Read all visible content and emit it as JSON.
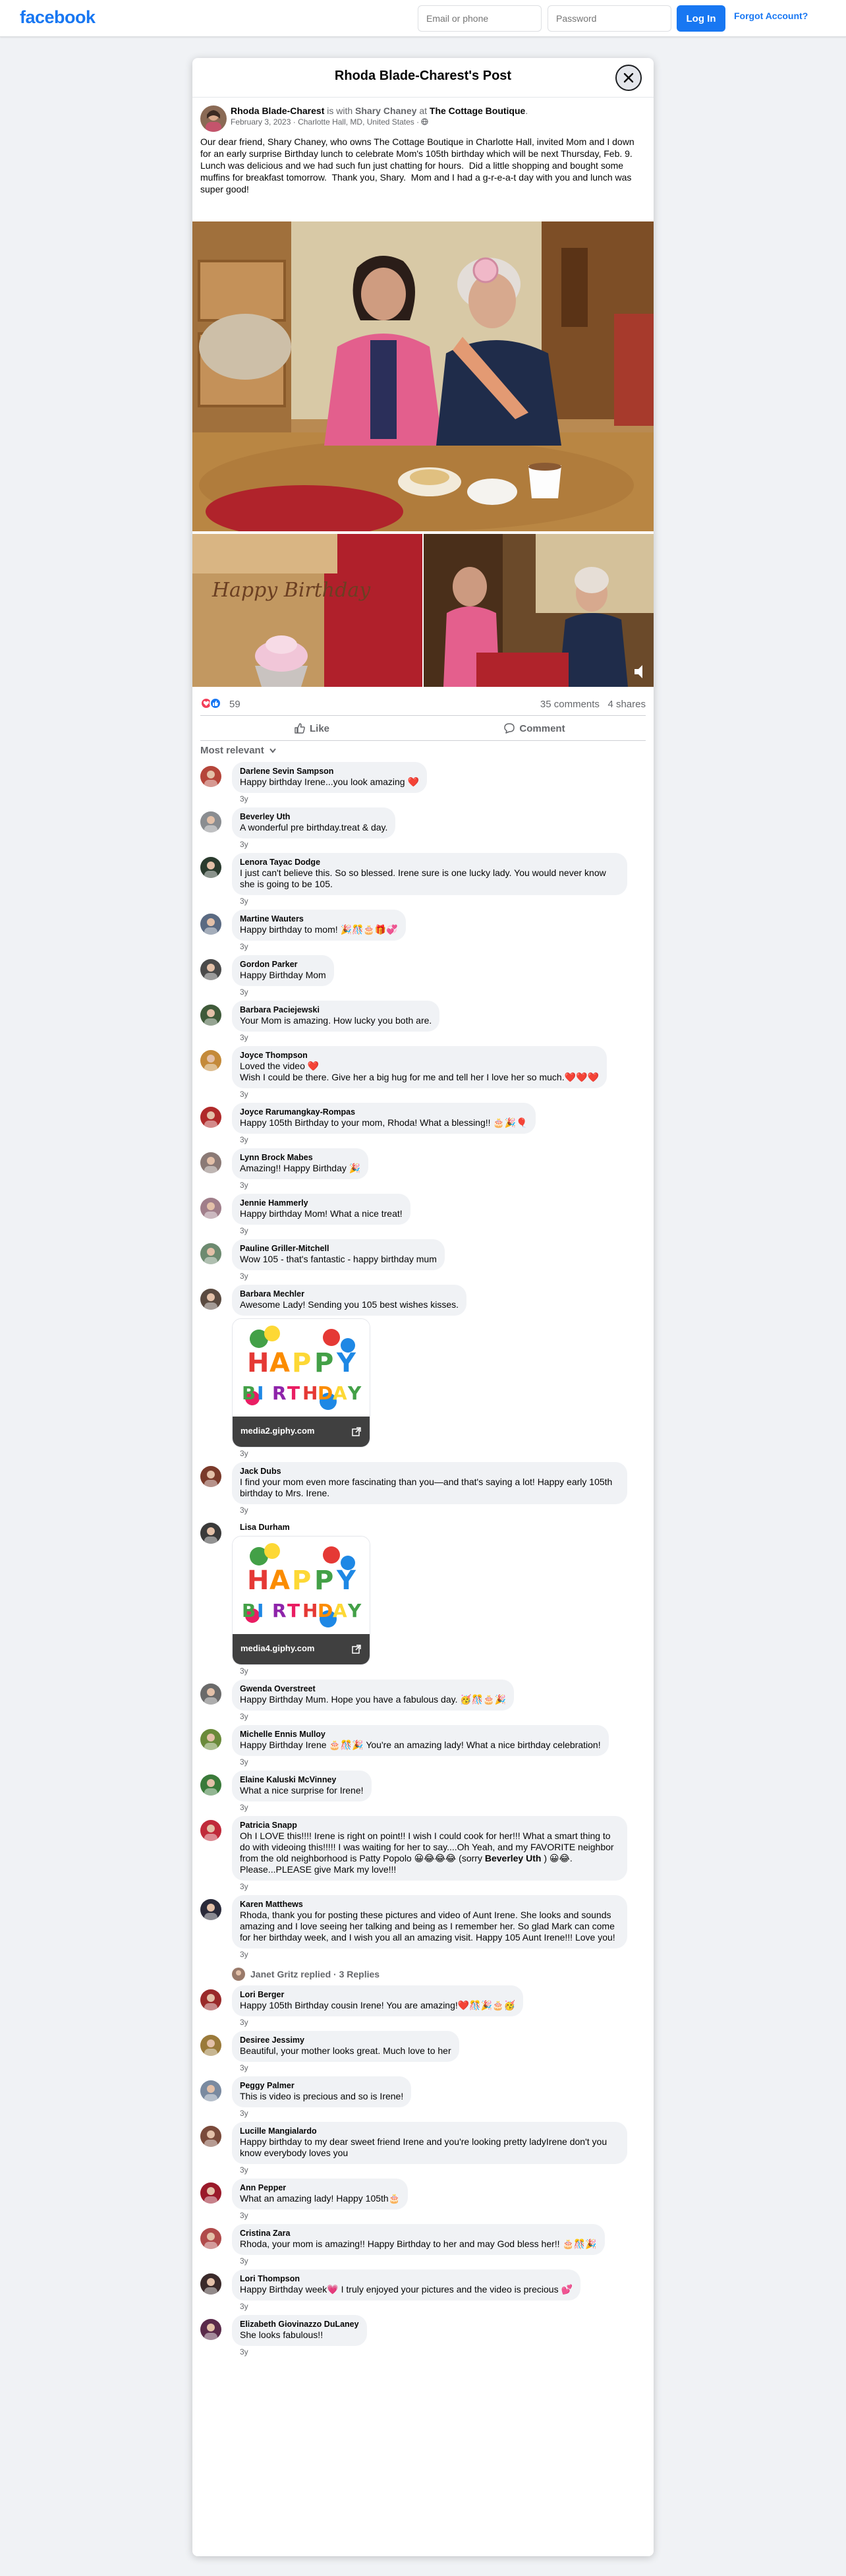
{
  "topbar": {
    "logo": "facebook",
    "email_placeholder": "Email or phone",
    "password_placeholder": "Password",
    "login_label": "Log In",
    "forgot_label": "Forgot Account?"
  },
  "dialog": {
    "title": "Rhoda Blade-Charest's Post"
  },
  "post": {
    "author": "Rhoda Blade-Charest",
    "is_with": "is with",
    "with_name": "Shary Chaney",
    "at": "at",
    "place": "The Cottage Boutique",
    "period": ".",
    "date": "February 3, 2023",
    "location": "Charlotte Hall, MD, United States",
    "text": "Our dear friend, Shary Chaney, who owns The Cottage Boutique in Charlotte Hall, invited Mom and I down for an early surprise Birthday lunch to celebrate Mom's 105th birthday which will be next Thursday, Feb. 9.  Lunch was delicious and we had such fun just chatting for hours.  Did a little shopping and bought some muffins for breakfast tomorrow.  Thank you, Shary.  Mom and I had a g-r-e-a-t day with you and lunch was super good!",
    "photo_text": "Happy Birthday",
    "reaction_count": "59",
    "comments_count": "35 comments",
    "shares_count": "4 shares",
    "like_label": "Like",
    "comment_label": "Comment",
    "sort_label": "Most relevant"
  },
  "comments": [
    {
      "name": "Darlene Sevin Sampson",
      "text": "Happy birthday Irene...you look amazing ❤️",
      "age": "3y"
    },
    {
      "name": "Beverley Uth",
      "text": "A wonderful pre birthday.treat & day.",
      "age": "3y"
    },
    {
      "name": "Lenora Tayac Dodge",
      "text": "I just can't believe this. So so blessed. Irene sure is one lucky lady. You would never know she is going to be 105.",
      "age": "3y"
    },
    {
      "name": "Martine Wauters",
      "text": "Happy birthday to mom! 🎉🎊🎂🎁💞",
      "age": "3y"
    },
    {
      "name": "Gordon Parker",
      "text": "Happy Birthday Mom",
      "age": "3y"
    },
    {
      "name": "Barbara Paciejewski",
      "text": "Your Mom is amazing. How lucky you both are.",
      "age": "3y"
    },
    {
      "name": "Joyce Thompson",
      "text": "Loved the video ❤️\nWish I could be there. Give her a big hug for me and tell her I love her so much.❤️❤️❤️",
      "age": "3y"
    },
    {
      "name": "Joyce Rarumangkay-Rompas",
      "text": "Happy 105th Birthday to your mom, Rhoda! What a blessing!! 🎂🎉🎈",
      "age": "3y"
    },
    {
      "name": "Lynn Brock Mabes",
      "text": "Amazing!! Happy Birthday 🎉",
      "age": "3y"
    },
    {
      "name": "Jennie Hammerly",
      "text": "Happy birthday Mom! What a nice treat!",
      "age": "3y"
    },
    {
      "name": "Pauline Griller-Mitchell",
      "text": "Wow 105 - that's fantastic - happy birthday mum",
      "age": "3y"
    },
    {
      "name": "Barbara Mechler",
      "text": "Awesome Lady! Sending you 105 best wishes kisses.",
      "age": "3y",
      "gif": "media2.giphy.com"
    },
    {
      "name": "Jack Dubs",
      "text": "I find your mom even more fascinating than you—and that's saying a lot! Happy early 105th birthday to Mrs. Irene.",
      "age": "3y"
    },
    {
      "name": "Lisa Durham",
      "text": "",
      "age": "3y",
      "gif": "media4.giphy.com"
    },
    {
      "name": "Gwenda Overstreet",
      "text": "Happy Birthday Mum. Hope you have a fabulous day. 🥳🎊🎂🎉",
      "age": "3y"
    },
    {
      "name": "Michelle Ennis Mulloy",
      "text": "Happy Birthday Irene 🎂🎊🎉 You're an amazing lady! What a nice birthday celebration!",
      "age": "3y"
    },
    {
      "name": "Elaine Kaluski McVinney",
      "text": "What a nice surprise for Irene!",
      "age": "3y"
    },
    {
      "name": "Patricia Snapp",
      "text": "Oh I LOVE this!!!! Irene is right on point!! I wish I could cook for her!!! What a smart thing to do with videoing this!!!!! I was waiting for her to say....Oh Yeah, and my FAVORITE neighbor from the old neighborhood is Patty Popolo 😀😂😂😂 (sorry ",
      "bold": "Beverley Uth",
      "text2": " ) 😀😂. Please...PLEASE give Mark my love!!!",
      "age": "3y"
    },
    {
      "name": "Karen Matthews",
      "text": "Rhoda, thank you for posting these pictures and video of Aunt Irene. She looks and sounds amazing and I love seeing her talking and being as I remember her. So glad Mark can come for her birthday week, and I wish you all an amazing visit. Happy 105 Aunt Irene!!! Love you!",
      "age": "3y"
    },
    {
      "name": "Lori Berger",
      "text": "Happy 105th Birthday cousin Irene! You are amazing!❤️🎊🎉🎂🥳",
      "age": "3y"
    },
    {
      "name": "Desiree Jessimy",
      "text": "Beautiful, your mother looks great. Much love to her",
      "age": "3y"
    },
    {
      "name": "Peggy Palmer",
      "text": "This is video is precious and so is Irene!",
      "age": "3y"
    },
    {
      "name": "Lucille Mangialardo",
      "text": "Happy birthday to my dear sweet friend Irene and you're looking pretty ladyIrene don't you know everybody loves you",
      "age": "3y"
    },
    {
      "name": "Ann Pepper",
      "text": "What an amazing lady! Happy 105th🎂",
      "age": "3y"
    },
    {
      "name": "Cristina Zara",
      "text": "Rhoda, your mom is amazing!! Happy Birthday to her and may God bless her!! 🎂🎊🎉",
      "age": "3y"
    },
    {
      "name": "Lori Thompson",
      "text": "Happy Birthday week💗 I truly enjoyed your pictures and the video is precious 💕",
      "age": "3y"
    },
    {
      "name": "Elizabeth Giovinazzo DuLaney",
      "text": "She looks fabulous!!",
      "age": "3y"
    }
  ],
  "replies_line": "Janet Gritz replied · 3 Replies",
  "gif_text": {
    "line1": "HAPPY",
    "line2": "BIRTHDAY"
  }
}
